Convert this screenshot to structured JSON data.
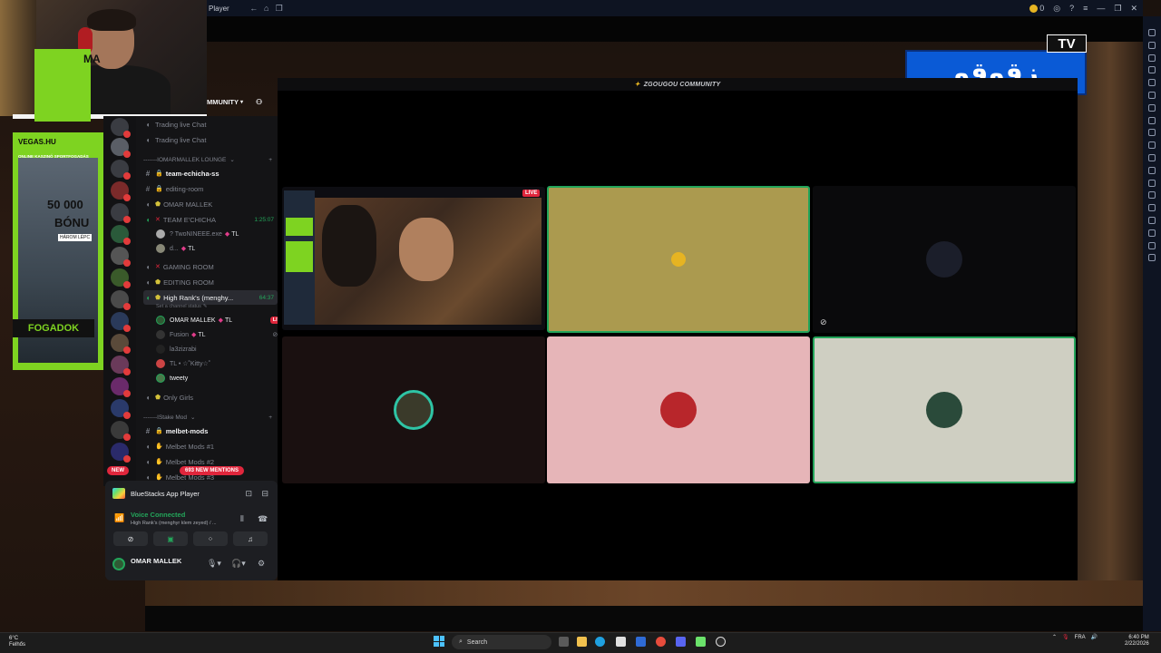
{
  "bluestacks": {
    "title": "Player",
    "coins": "0"
  },
  "ad": {
    "brand": "VEGAS.HU",
    "subtitle": "ONLINE KASZINÓ SPORTFOGADÁS",
    "amount_top": "MA",
    "amount": "50 000",
    "bonus": "BÓNU",
    "steps": "HÁROM LÉPC",
    "button": "FOGADOK"
  },
  "logo": {
    "arabic": "زقوقو",
    "tv": "TV"
  },
  "discord": {
    "server_name": "MMUNITY",
    "call_header": "ZGOUGOU COMMUNITY",
    "channels": [
      {
        "label": "Trading live Chat",
        "icon": "speaker-icon"
      },
      {
        "label": "Trading live Chat",
        "icon": "speaker-icon"
      },
      {
        "label": "-------IOMARMALLEK LOUNGE",
        "type": "category"
      },
      {
        "label": "team-echicha-ss",
        "icon": "hash-icon"
      },
      {
        "label": "editing-room",
        "icon": "hash-icon"
      },
      {
        "label": "OMAR MALLEK",
        "icon": "speaker-icon"
      },
      {
        "label": "TEAM E'CHICHA",
        "icon": "speaker-icon",
        "timer": "1:25:07"
      },
      {
        "label": "? TwoNINEEE.exe",
        "user": true,
        "tag": "TL"
      },
      {
        "label": "d...",
        "user": true,
        "tag": "TL"
      },
      {
        "label": "GAMING ROOM",
        "icon": "speaker-icon"
      },
      {
        "label": "EDITING ROOM",
        "icon": "speaker-icon"
      },
      {
        "label": "High Rank's (menghy...",
        "icon": "speaker-icon",
        "timer": "64:37"
      },
      {
        "label": "Set a channel status",
        "type": "status"
      },
      {
        "label": "OMAR MALLEK",
        "user": true,
        "tag": "TL",
        "live": "LIVE"
      },
      {
        "label": "Fusion",
        "user": true,
        "tag": "TL"
      },
      {
        "label": "la3zizrabi",
        "user": true
      },
      {
        "label": "TL • ☆˚Kitty☆˚",
        "user": true
      },
      {
        "label": "tweety",
        "user": true
      },
      {
        "label": "Only Girls",
        "icon": "speaker-icon"
      },
      {
        "label": "-------IStake Mod",
        "type": "category"
      },
      {
        "label": "melbet-mods",
        "icon": "hash-icon"
      },
      {
        "label": "Melbet Mods #1",
        "icon": "speaker-icon"
      },
      {
        "label": "Melbet Mods #2",
        "icon": "speaker-icon"
      },
      {
        "label": "Melbet Mods #3",
        "icon": "speaker-icon"
      }
    ],
    "new_pill": "NEW",
    "mentions_pill": "693 NEW MENTIONS",
    "panel": {
      "app": "BlueStacks App Player",
      "voice_status": "Voice Connected",
      "voice_channel": "High Rank's (menghyr klem zeyed) / ...",
      "username": "OMAR MALLEK"
    },
    "live_tag": "LIVE"
  },
  "taskbar": {
    "temp": "6°C",
    "weather": "Felhős",
    "search": "Search",
    "lang": "FRA",
    "time": "6:40 PM",
    "date": "2/22/2026"
  }
}
